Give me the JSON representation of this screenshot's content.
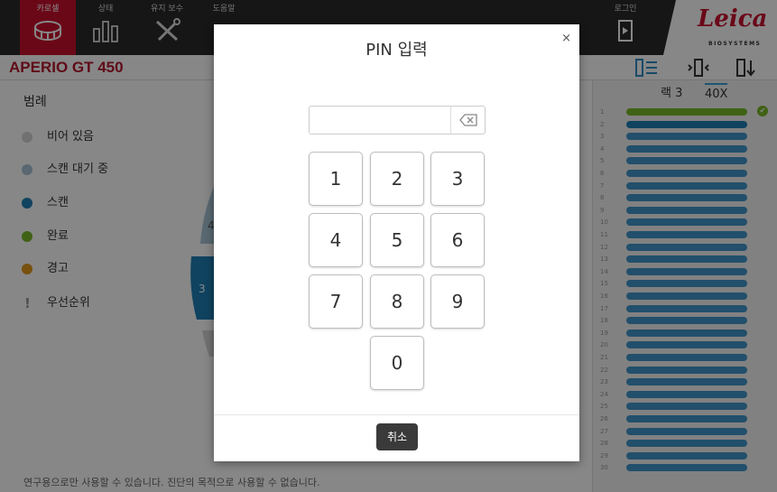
{
  "nav": {
    "carousel_label": "카로셀",
    "status_label": "상태",
    "maintenance_label": "유지 보수",
    "help_label": "도움말",
    "login_label": "로그인"
  },
  "brand": {
    "logo_text": "Leica",
    "logo_sub": "BIOSYSTEMS",
    "brand_color": "#c8102e"
  },
  "device": {
    "title": "APERIO GT 450"
  },
  "legend": {
    "title": "범례",
    "items": [
      {
        "label": "비어 있음",
        "color": "#d6d6d6"
      },
      {
        "label": "스캔 대기 중",
        "color": "#a9c4d6"
      },
      {
        "label": "스캔",
        "color": "#1f7fb5"
      },
      {
        "label": "완료",
        "color": "#7ab929"
      },
      {
        "label": "경고",
        "color": "#e39a1c"
      },
      {
        "label": "우선순위",
        "icon": "exclamation-icon"
      }
    ]
  },
  "carousel_wheel": {
    "visible_slots": [
      "4",
      "3"
    ]
  },
  "rack": {
    "label": "랙 3",
    "magnification": "40X",
    "slot_numbers": [
      "1",
      "2",
      "3",
      "4",
      "5",
      "6",
      "7",
      "8",
      "9",
      "10",
      "11",
      "12",
      "13",
      "14",
      "15",
      "16",
      "17",
      "18",
      "19",
      "20",
      "21",
      "22",
      "23",
      "24",
      "25",
      "26",
      "27",
      "28",
      "29",
      "30"
    ],
    "slot_states": [
      "complete",
      "scanning",
      "pending",
      "pending",
      "pending",
      "pending",
      "pending",
      "pending",
      "pending",
      "pending",
      "pending",
      "pending",
      "pending",
      "pending",
      "pending",
      "pending",
      "pending",
      "pending",
      "pending",
      "pending",
      "pending",
      "pending",
      "pending",
      "pending",
      "pending",
      "pending",
      "pending",
      "pending",
      "pending",
      "pending"
    ],
    "state_colors": {
      "complete": "#7ab929",
      "scanning": "#1f7fb5",
      "pending": "#2e8cc5"
    }
  },
  "footer": {
    "note": "연구용으로만 사용할 수 있습니다. 진단의 목적으로 사용할 수 없습니다."
  },
  "dialog": {
    "title": "PIN 입력",
    "close": "×",
    "pin_value": "",
    "keys": [
      "1",
      "2",
      "3",
      "4",
      "5",
      "6",
      "7",
      "8",
      "9",
      "0"
    ],
    "cancel_label": "취소"
  }
}
